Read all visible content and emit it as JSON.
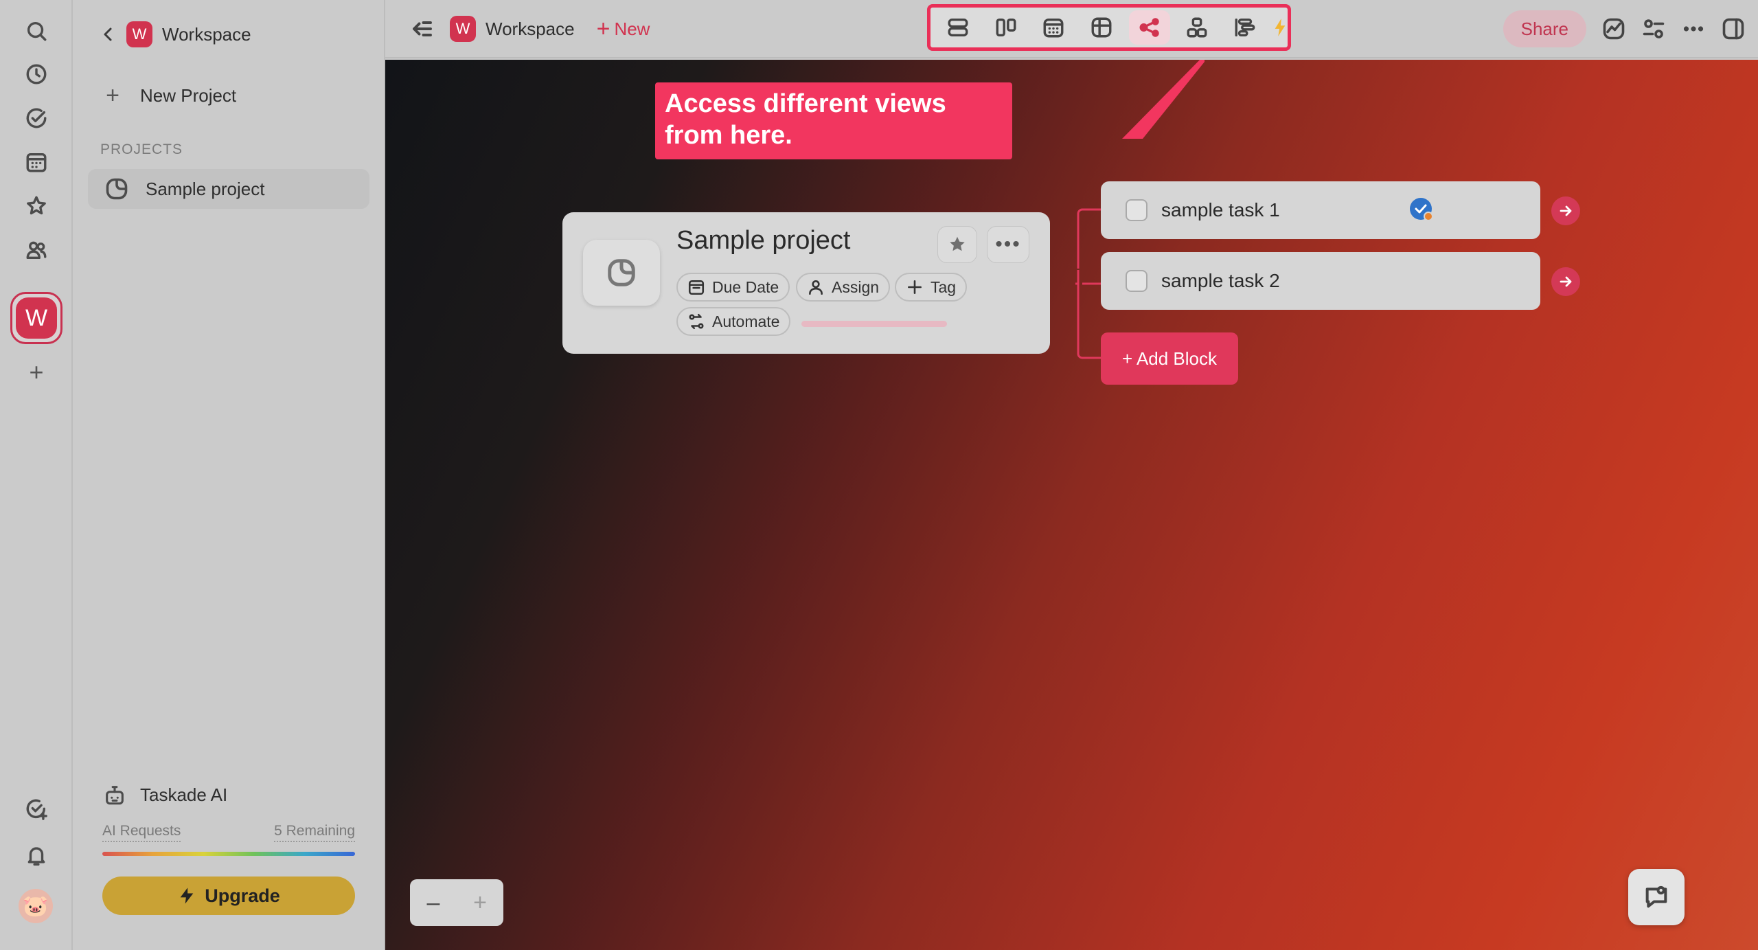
{
  "rail": {
    "icons": [
      "search-icon",
      "clock-icon",
      "check-circle-icon",
      "calendar-icon",
      "star-icon",
      "users-icon"
    ],
    "workspace_letter": "W",
    "add_label": "+",
    "bottom_icons": [
      "add-check-icon",
      "bell-icon"
    ],
    "user_avatar": "🐷"
  },
  "sidebar": {
    "workspace_letter": "W",
    "workspace_title": "Workspace",
    "new_project_label": "New Project",
    "section_label": "PROJECTS",
    "projects": [
      {
        "label": "Sample project"
      }
    ],
    "ai": {
      "label": "Taskade AI",
      "requests_label": "AI Requests",
      "remaining_label": "5 Remaining",
      "remaining_fraction": 1.0
    },
    "upgrade_label": "Upgrade"
  },
  "topbar": {
    "workspace_letter": "W",
    "workspace_name": "Workspace",
    "new_label": "New",
    "views": [
      {
        "name": "list-view-icon",
        "active": false
      },
      {
        "name": "board-view-icon",
        "active": false
      },
      {
        "name": "calendar-view-icon",
        "active": false
      },
      {
        "name": "table-view-icon",
        "active": false
      },
      {
        "name": "mindmap-view-icon",
        "active": true
      },
      {
        "name": "org-chart-view-icon",
        "active": false
      },
      {
        "name": "gantt-view-icon",
        "active": false
      }
    ],
    "share_label": "Share"
  },
  "tooltip": {
    "text": "Access different views from here."
  },
  "project_card": {
    "title": "Sample project",
    "chips": {
      "due_date": "Due Date",
      "assign": "Assign",
      "tag": "Tag",
      "automate": "Automate"
    },
    "progress_fraction": 0.0
  },
  "tasks": [
    {
      "label": "sample task 1",
      "has_badge": true
    },
    {
      "label": "sample task 2",
      "has_badge": false
    }
  ],
  "add_block_label": "+ Add Block",
  "zoom": {
    "out_label": "–",
    "in_label": "+"
  },
  "colors": {
    "accent": "#d1334f",
    "highlight": "#ea2f58",
    "tooltip_bg": "#f2365f",
    "upgrade_bg": "#c9a235"
  }
}
